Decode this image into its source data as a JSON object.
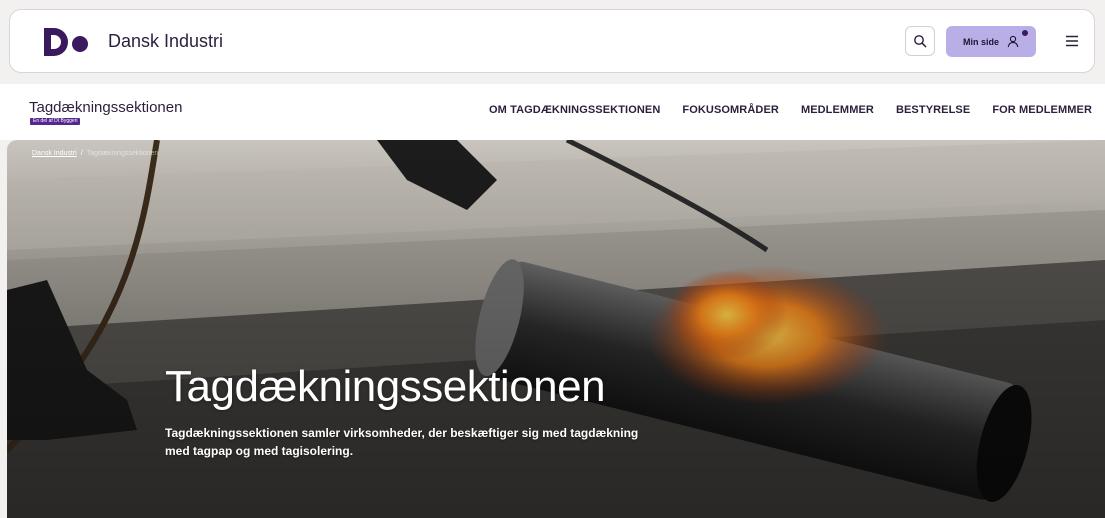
{
  "header": {
    "brand": "Dansk Industri",
    "min_side_label": "Min side"
  },
  "section": {
    "title": "Tagdækningssektionen",
    "badge": "En del af DI Byggeri",
    "nav": [
      {
        "label": "OM TAGDÆKNINGSSEKTIONEN"
      },
      {
        "label": "FOKUSOMRÅDER"
      },
      {
        "label": "MEDLEMMER"
      },
      {
        "label": "BESTYRELSE"
      },
      {
        "label": "FOR MEDLEMMER"
      }
    ]
  },
  "breadcrumb": {
    "home": "Dansk Industri",
    "separator": "/",
    "current": "Tagdækningssektionen"
  },
  "hero": {
    "title": "Tagdækningssektionen",
    "text": "Tagdækningssektionen samler virksomheder, der beskæftiger sig med tagdækning med tagpap og med tagisolering."
  },
  "colors": {
    "brand_purple": "#3a1a5e",
    "button_lavender": "#b9afe6",
    "badge_purple": "#55288f"
  },
  "icons": {
    "search": "search-icon",
    "user": "user-icon",
    "menu": "hamburger-menu-icon"
  }
}
